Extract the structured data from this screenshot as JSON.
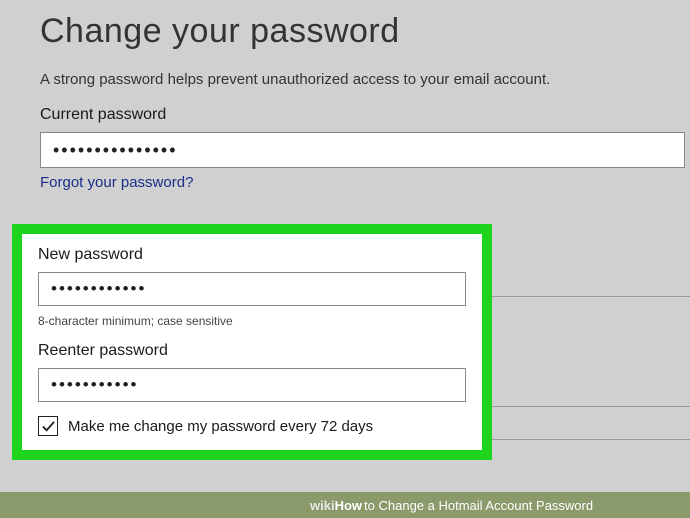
{
  "heading": "Change your password",
  "subtitle": "A strong password helps prevent unauthorized access to your email account.",
  "current": {
    "label": "Current password",
    "value": "•••••••••••••••"
  },
  "forgot_link": "Forgot your password?",
  "new": {
    "label": "New password",
    "value": "••••••••••••",
    "hint": "8-character minimum; case sensitive"
  },
  "reenter": {
    "label": "Reenter password",
    "value": "•••••••••••"
  },
  "checkbox_label": "Make me change my password every 72 days",
  "caption": {
    "brand1": "wiki",
    "brand2": "How",
    "rest": " to Change a Hotmail Account Password"
  }
}
